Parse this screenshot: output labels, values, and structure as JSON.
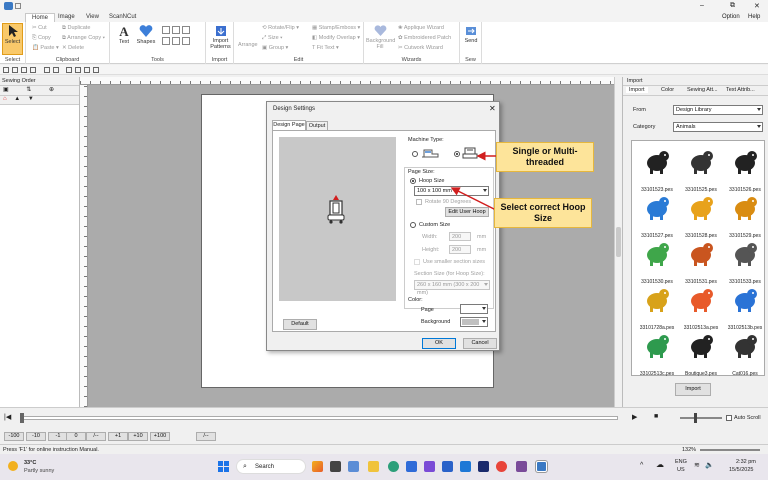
{
  "titlebar": {
    "minimize": "–",
    "restore": "⧉",
    "close": "✕",
    "option": "Option",
    "help": "Help"
  },
  "tabs": [
    {
      "label": "Home",
      "active": true
    },
    {
      "label": "Image",
      "active": false
    },
    {
      "label": "View",
      "active": false
    },
    {
      "label": "ScanNCut",
      "active": false
    }
  ],
  "ribbon": {
    "select": {
      "button": "Select",
      "group": "Select"
    },
    "clipboard": {
      "cut": "Cut",
      "copy": "Copy",
      "paste": "Paste",
      "duplicate": "Duplicate",
      "arrange_copy": "Arrange Copy",
      "delete": "Delete",
      "group": "Clipboard"
    },
    "tools": {
      "text": "Text",
      "shapes": "Shapes",
      "group": "Tools"
    },
    "import": {
      "button": "Import Patterns",
      "group": "Import"
    },
    "edit": {
      "arrange": "Arrange",
      "rotate_flip": "Rotate/Flip",
      "size": "Size",
      "group_btn": "Group",
      "stamp": "Stamp/Emboss",
      "modify_overlap": "Modify Overlap",
      "fit_text": "Fit Text",
      "group": "Edit"
    },
    "wizards": {
      "background_fill": "Background Fill",
      "applique": "Applique Wizard",
      "embroidered_patch": "Embroidered Patch",
      "cutwork": "Cutwork Wizard",
      "group": "Wizards"
    },
    "sew": {
      "button": "Send",
      "group": "Sew"
    }
  },
  "left_pane": {
    "title": "Sewing Order"
  },
  "dialog": {
    "title": "Design Settings",
    "close": "✕",
    "tabs": [
      "Design Page",
      "Output"
    ],
    "machine_type_label": "Machine Type:",
    "page_size_label": "Page Size:",
    "hoop_size_label": "Hoop Size",
    "hoop_size_value": "100 x 100 mm",
    "rotate_label": "Rotate 90 Degrees",
    "edit_user_hoop": "Edit User Hoop",
    "custom_size_label": "Custom Size",
    "width_label": "Width:",
    "width_value": "200",
    "height_label": "Height:",
    "height_value": "200",
    "unit": "mm",
    "smaller_section": "Use smaller section sizes",
    "section_size_label": "Section Size (for Hoop Size):",
    "section_size_value": "260 x 160 mm (300 x 200 mm)",
    "color_label": "Color:",
    "page_label": "Page",
    "background_label": "Background",
    "default_button": "Default",
    "ok_button": "OK",
    "cancel_button": "Cancel",
    "page_color": "#ffffff",
    "background_color": "#c0c0c0"
  },
  "callouts": {
    "machine": "Single or Multi-threaded",
    "hoop": "Select correct Hoop Size"
  },
  "right_pane": {
    "title": "Import",
    "tabs": [
      "Import",
      "Color",
      "Sewing Att...",
      "Text Attrib..."
    ],
    "from_label": "From",
    "from_value": "Design Library",
    "category_label": "Category",
    "category_value": "Animals",
    "import_button": "Import",
    "designs": [
      {
        "label": "33101523.pes",
        "color": "#222222"
      },
      {
        "label": "33101525.pes",
        "color": "#333333"
      },
      {
        "label": "33101526.pes",
        "color": "#222222"
      },
      {
        "label": "33101527.pes",
        "color": "#2a7bd6"
      },
      {
        "label": "33101528.pes",
        "color": "#e8a21b"
      },
      {
        "label": "33101529.pes",
        "color": "#d98c12"
      },
      {
        "label": "33101530.pes",
        "color": "#3fa64a"
      },
      {
        "label": "33101531.pes",
        "color": "#c9551f"
      },
      {
        "label": "33101533.pes",
        "color": "#555555"
      },
      {
        "label": "33101728a.pes",
        "color": "#d8a21a"
      },
      {
        "label": "33102513a.pes",
        "color": "#e85a2a"
      },
      {
        "label": "33102513b.pes",
        "color": "#2a73d6"
      },
      {
        "label": "33102513c.pes",
        "color": "#2e9a4e"
      },
      {
        "label": "Boutique3.pes",
        "color": "#222222"
      },
      {
        "label": "Cat016.pes",
        "color": "#333333"
      }
    ]
  },
  "playbar": {
    "auto_scroll": "Auto Scroll"
  },
  "stitch_bar": {
    "items": [
      "-100",
      "-10",
      "-1",
      "0",
      "/--",
      "+1",
      "+10",
      "+100",
      "/--"
    ]
  },
  "status": {
    "text": "Press 'F1' for online instruction Manual.",
    "zoom": "132%"
  },
  "taskbar": {
    "weather_temp": "33°C",
    "weather_desc": "Partly sunny",
    "search": "Search",
    "lang": "ENG",
    "region": "US",
    "time": "2:32 pm",
    "date": "15/5/2025"
  },
  "colors": {
    "accent": "#f5b335",
    "select_bg": "#f9c96a",
    "callout": "#fde49a",
    "arrow": "#d11f1f"
  }
}
